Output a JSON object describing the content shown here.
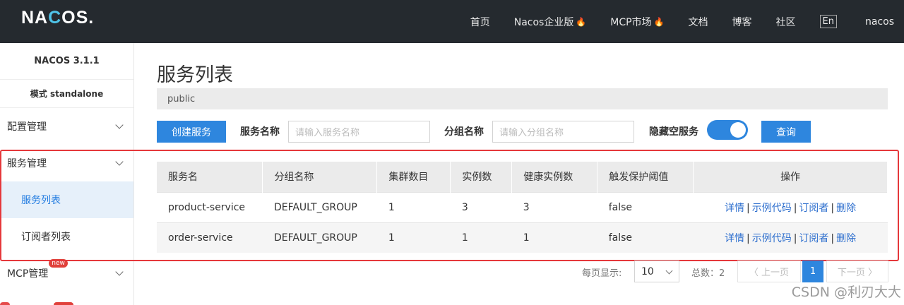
{
  "topbar": {
    "logo_left": "NA",
    "logo_mid": "C",
    "logo_right": "OS.",
    "nav": [
      "首页",
      "Nacos企业版",
      "MCP市场",
      "文档",
      "博客",
      "社区"
    ],
    "fire_icon": "🔥",
    "lang": "En",
    "user": "nacos"
  },
  "sidebar": {
    "version": "NACOS 3.1.1",
    "mode": "模式 standalone",
    "groups": {
      "config": "配置管理",
      "service": "服务管理",
      "mcp": "MCP管理"
    },
    "service_items": [
      "服务列表",
      "订阅者列表"
    ],
    "new_badge": "new"
  },
  "main": {
    "title": "服务列表",
    "namespace": "public",
    "create_button": "创建服务",
    "service_name_label": "服务名称",
    "service_name_placeholder": "请输入服务名称",
    "group_name_label": "分组名称",
    "group_name_placeholder": "请输入分组名称",
    "hide_empty_label": "隐藏空服务",
    "hide_empty_on": true,
    "query_button": "查询"
  },
  "table": {
    "headers": [
      "服务名",
      "分组名称",
      "集群数目",
      "实例数",
      "健康实例数",
      "触发保护阈值",
      "操作"
    ],
    "rows": [
      [
        "product-service",
        "DEFAULT_GROUP",
        "1",
        "3",
        "3",
        "false"
      ],
      [
        "order-service",
        "DEFAULT_GROUP",
        "1",
        "1",
        "1",
        "false"
      ]
    ],
    "ops": [
      "详情",
      "示例代码",
      "订阅者",
      "删除"
    ],
    "ops_sep": "|"
  },
  "pagination": {
    "per_page_label": "每页显示:",
    "per_page": "10",
    "total": "总数：2",
    "prev": "〈 上一页",
    "current": "1",
    "next": "下一页 〉"
  },
  "watermark": "CSDN @利刃大大",
  "colors": {
    "topbar": "#252a2f",
    "primary": "#2e86de",
    "link": "#2e6fce",
    "highlight_frame": "#e5383b",
    "active_menu_bg": "#e6f0fa"
  }
}
